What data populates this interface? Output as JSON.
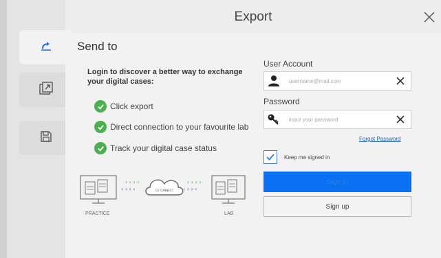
{
  "dialog": {
    "title": "Export"
  },
  "sidebar": {
    "items": [
      {
        "name": "send-to",
        "icon": "share-icon",
        "active": true
      },
      {
        "name": "export-file",
        "icon": "export-icon",
        "active": false
      },
      {
        "name": "save",
        "icon": "save-icon",
        "active": false
      }
    ]
  },
  "main": {
    "heading": "Send to",
    "intro": "Login to discover a better way to exchange your digital cases:",
    "features": [
      "Click export",
      "Direct connection to your favourite lab",
      "Track your digital case status"
    ],
    "diagram": {
      "left_label": "PRACTICE",
      "right_label": "LAB",
      "cloud_label": "CS CONNECT"
    }
  },
  "login": {
    "account_label": "User Account",
    "username_placeholder": "username@mail.com",
    "password_label": "Password",
    "password_placeholder": "input your password",
    "forgot_label": "Forgot Password",
    "keep_signed_in_label": "Keep me signed in",
    "keep_signed_in_checked": true,
    "sign_in_label": "Sign in",
    "sign_up_label": "Sign up"
  },
  "colors": {
    "accent": "#0a6ff0",
    "check_green": "#4caf50",
    "link": "#1f5fbf",
    "arrow_green": "#3cb043",
    "arrow_blue": "#2a6fd6"
  }
}
